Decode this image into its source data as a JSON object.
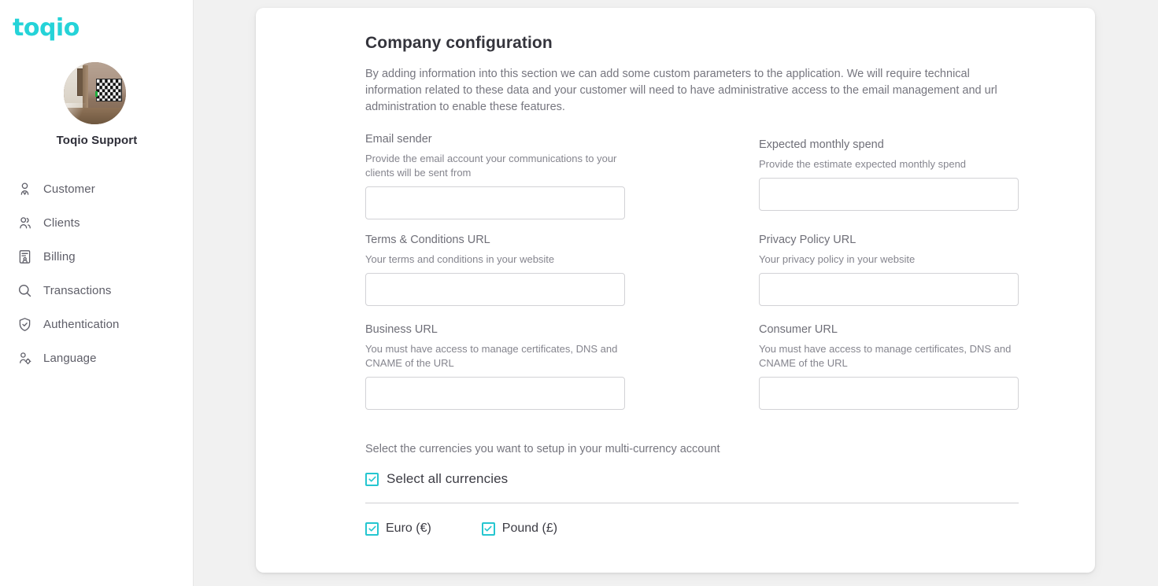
{
  "brand": {
    "logo_text": "toqio",
    "logo_color": "#25d3d8",
    "accent_color": "#25c6d0"
  },
  "sidebar": {
    "profile": {
      "name": "Toqio Support",
      "avatar_alt": "room-photo-avatar"
    },
    "items": [
      {
        "label": "Customer",
        "icon": "user-icon"
      },
      {
        "label": "Clients",
        "icon": "users-icon"
      },
      {
        "label": "Billing",
        "icon": "document-user-icon"
      },
      {
        "label": "Transactions",
        "icon": "search-icon"
      },
      {
        "label": "Authentication",
        "icon": "shield-check-icon"
      },
      {
        "label": "Language",
        "icon": "user-gear-icon"
      }
    ]
  },
  "main": {
    "title": "Company configuration",
    "description": "By adding information into this section we can add some custom parameters to the application. We will require technical information related to these data and your customer will need to have administrative access to the email management and url administration to enable these features.",
    "fields": {
      "email_sender": {
        "label": "Email sender",
        "help": "Provide the email account your communications to your clients will be sent from",
        "value": "",
        "placeholder": ""
      },
      "expected_monthly_spend": {
        "label": "Expected monthly spend",
        "help": "Provide the estimate expected monthly spend",
        "value": "",
        "placeholder": ""
      },
      "terms_url": {
        "label": "Terms & Conditions URL",
        "help": "Your terms and conditions in your website",
        "value": "",
        "placeholder": ""
      },
      "privacy_url": {
        "label": "Privacy Policy URL",
        "help": "Your privacy policy in your website",
        "value": "",
        "placeholder": ""
      },
      "business_url": {
        "label": "Business URL",
        "help": "You must have access to manage certificates, DNS and CNAME of the URL",
        "value": "",
        "placeholder": ""
      },
      "consumer_url": {
        "label": "Consumer URL",
        "help": "You must have access to manage certificates, DNS and CNAME of the URL",
        "value": "",
        "placeholder": ""
      }
    },
    "currencies": {
      "intro": "Select the currencies you want to setup in your multi-currency account",
      "select_all_label": "Select all currencies",
      "select_all_checked": true,
      "options": [
        {
          "label": "Euro (€)",
          "checked": true
        },
        {
          "label": "Pound (£)",
          "checked": true
        }
      ]
    }
  }
}
